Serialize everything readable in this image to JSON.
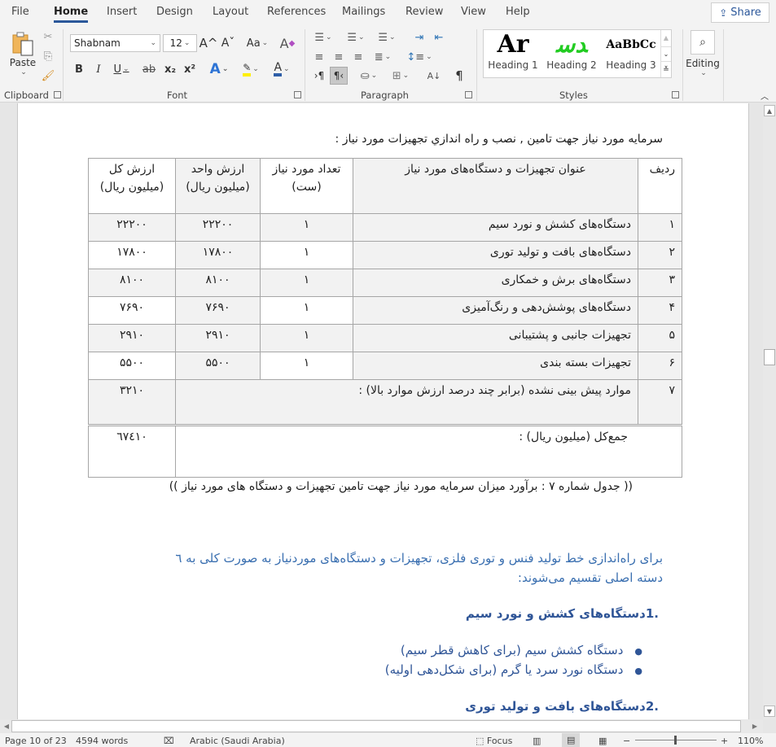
{
  "tabs": [
    "File",
    "Home",
    "Insert",
    "Design",
    "Layout",
    "References",
    "Mailings",
    "Review",
    "View",
    "Help"
  ],
  "active_tab": "Home",
  "share_label": "Share",
  "ribbon": {
    "clipboard": {
      "paste_label": "Paste",
      "group_label": "Clipboard"
    },
    "font": {
      "name": "Shabnam",
      "size": "12",
      "group_label": "Font",
      "bold": "B",
      "italic": "I",
      "underline": "U",
      "strike": "ab",
      "subscript": "x₂",
      "superscript": "x²",
      "grow": "A^",
      "shrink": "Aˇ",
      "case": "Aa",
      "text_effects": "A",
      "font_color": "A",
      "clear": "A"
    },
    "paragraph": {
      "group_label": "Paragraph",
      "pilcrow": "¶",
      "ltr": "›¶",
      "rtl": "¶‹"
    },
    "styles": {
      "group_label": "Styles",
      "items": [
        {
          "preview": "Ar",
          "name": "Heading 1",
          "color": "#000000"
        },
        {
          "preview": "ﺪﺳ",
          "name": "Heading 2",
          "color": "#22cc22"
        },
        {
          "preview": "AaBbCc",
          "name": "Heading 3",
          "color": "#000000"
        }
      ]
    },
    "editing": {
      "label": "Editing"
    }
  },
  "document": {
    "intro": "سرمايه مورد نياز جهت تامين , نصب و راه اندازي تجهيزات مورد نياز :",
    "table": {
      "headers": [
        "ردیف",
        "عنوان تجهیزات و دستگاه‌های مورد نیاز",
        "تعداد مورد نیاز (ست)",
        "ارزش واحد (میلیون ریال)",
        "ارزش کل (میلیون ریال)"
      ],
      "rows": [
        {
          "index": "۱",
          "title": "دستگاه‌های کشش و نورد سیم",
          "qty": "۱",
          "unit": "۲۲۲۰۰",
          "total": "۲۲۲۰۰"
        },
        {
          "index": "۲",
          "title": "دستگاه‌های بافت و تولید توری",
          "qty": "۱",
          "unit": "۱۷۸۰۰",
          "total": "۱۷۸۰۰"
        },
        {
          "index": "۳",
          "title": "دستگاه‌های برش و خمکاری",
          "qty": "۱",
          "unit": "۸۱۰۰",
          "total": "۸۱۰۰"
        },
        {
          "index": "۴",
          "title": "دستگاه‌های پوشش‌دهی و رنگ‌آمیزی",
          "qty": "۱",
          "unit": "۷۶۹۰",
          "total": "۷۶۹۰"
        },
        {
          "index": "۵",
          "title": "تجهیزات جانبی و پشتیبانی",
          "qty": "۱",
          "unit": "۲۹۱۰",
          "total": "۲۹۱۰"
        },
        {
          "index": "۶",
          "title": "تجهیزات بسته بندی",
          "qty": "۱",
          "unit": "۵۵۰۰",
          "total": "۵۵۰۰"
        }
      ],
      "unforeseen": {
        "index": "۷",
        "title": "موارد پیش بینی نشده (برابر چند درصد ارزش موارد بالا) :",
        "total": "۳۲۱۰"
      },
      "sum": {
        "label": "جمع‌کل (میلیون ریال) :",
        "total": "٦٧٤١٠"
      }
    },
    "caption": "(( جدول شماره ۷ : برآورد میزان سرمایه مورد نیاز جهت تامین تجهیزات و دستگاه های مورد نیاز ))",
    "para_line1": "برای راه‌اندازی خط تولید فنس و توری فلزی، تجهیزات و دستگاه‌های موردنیاز به صورت کلی به ٦",
    "para_line2": "دسته اصلی تقسیم می‌شوند:",
    "heading1": ".1دستگاه‌های کشش و نورد سیم",
    "bullets": [
      "دستگاه کشش سیم (برای کاهش قطر سیم)",
      "دستگاه نورد سرد یا گرم (برای شکل‌دهی اولیه)"
    ],
    "heading2": ".2دستگاه‌های بافت و تولید توری"
  },
  "status": {
    "page": "Page 10 of 23",
    "words": "4594 words",
    "language": "Arabic (Saudi Arabia)",
    "focus": "Focus",
    "zoom": "110%"
  }
}
